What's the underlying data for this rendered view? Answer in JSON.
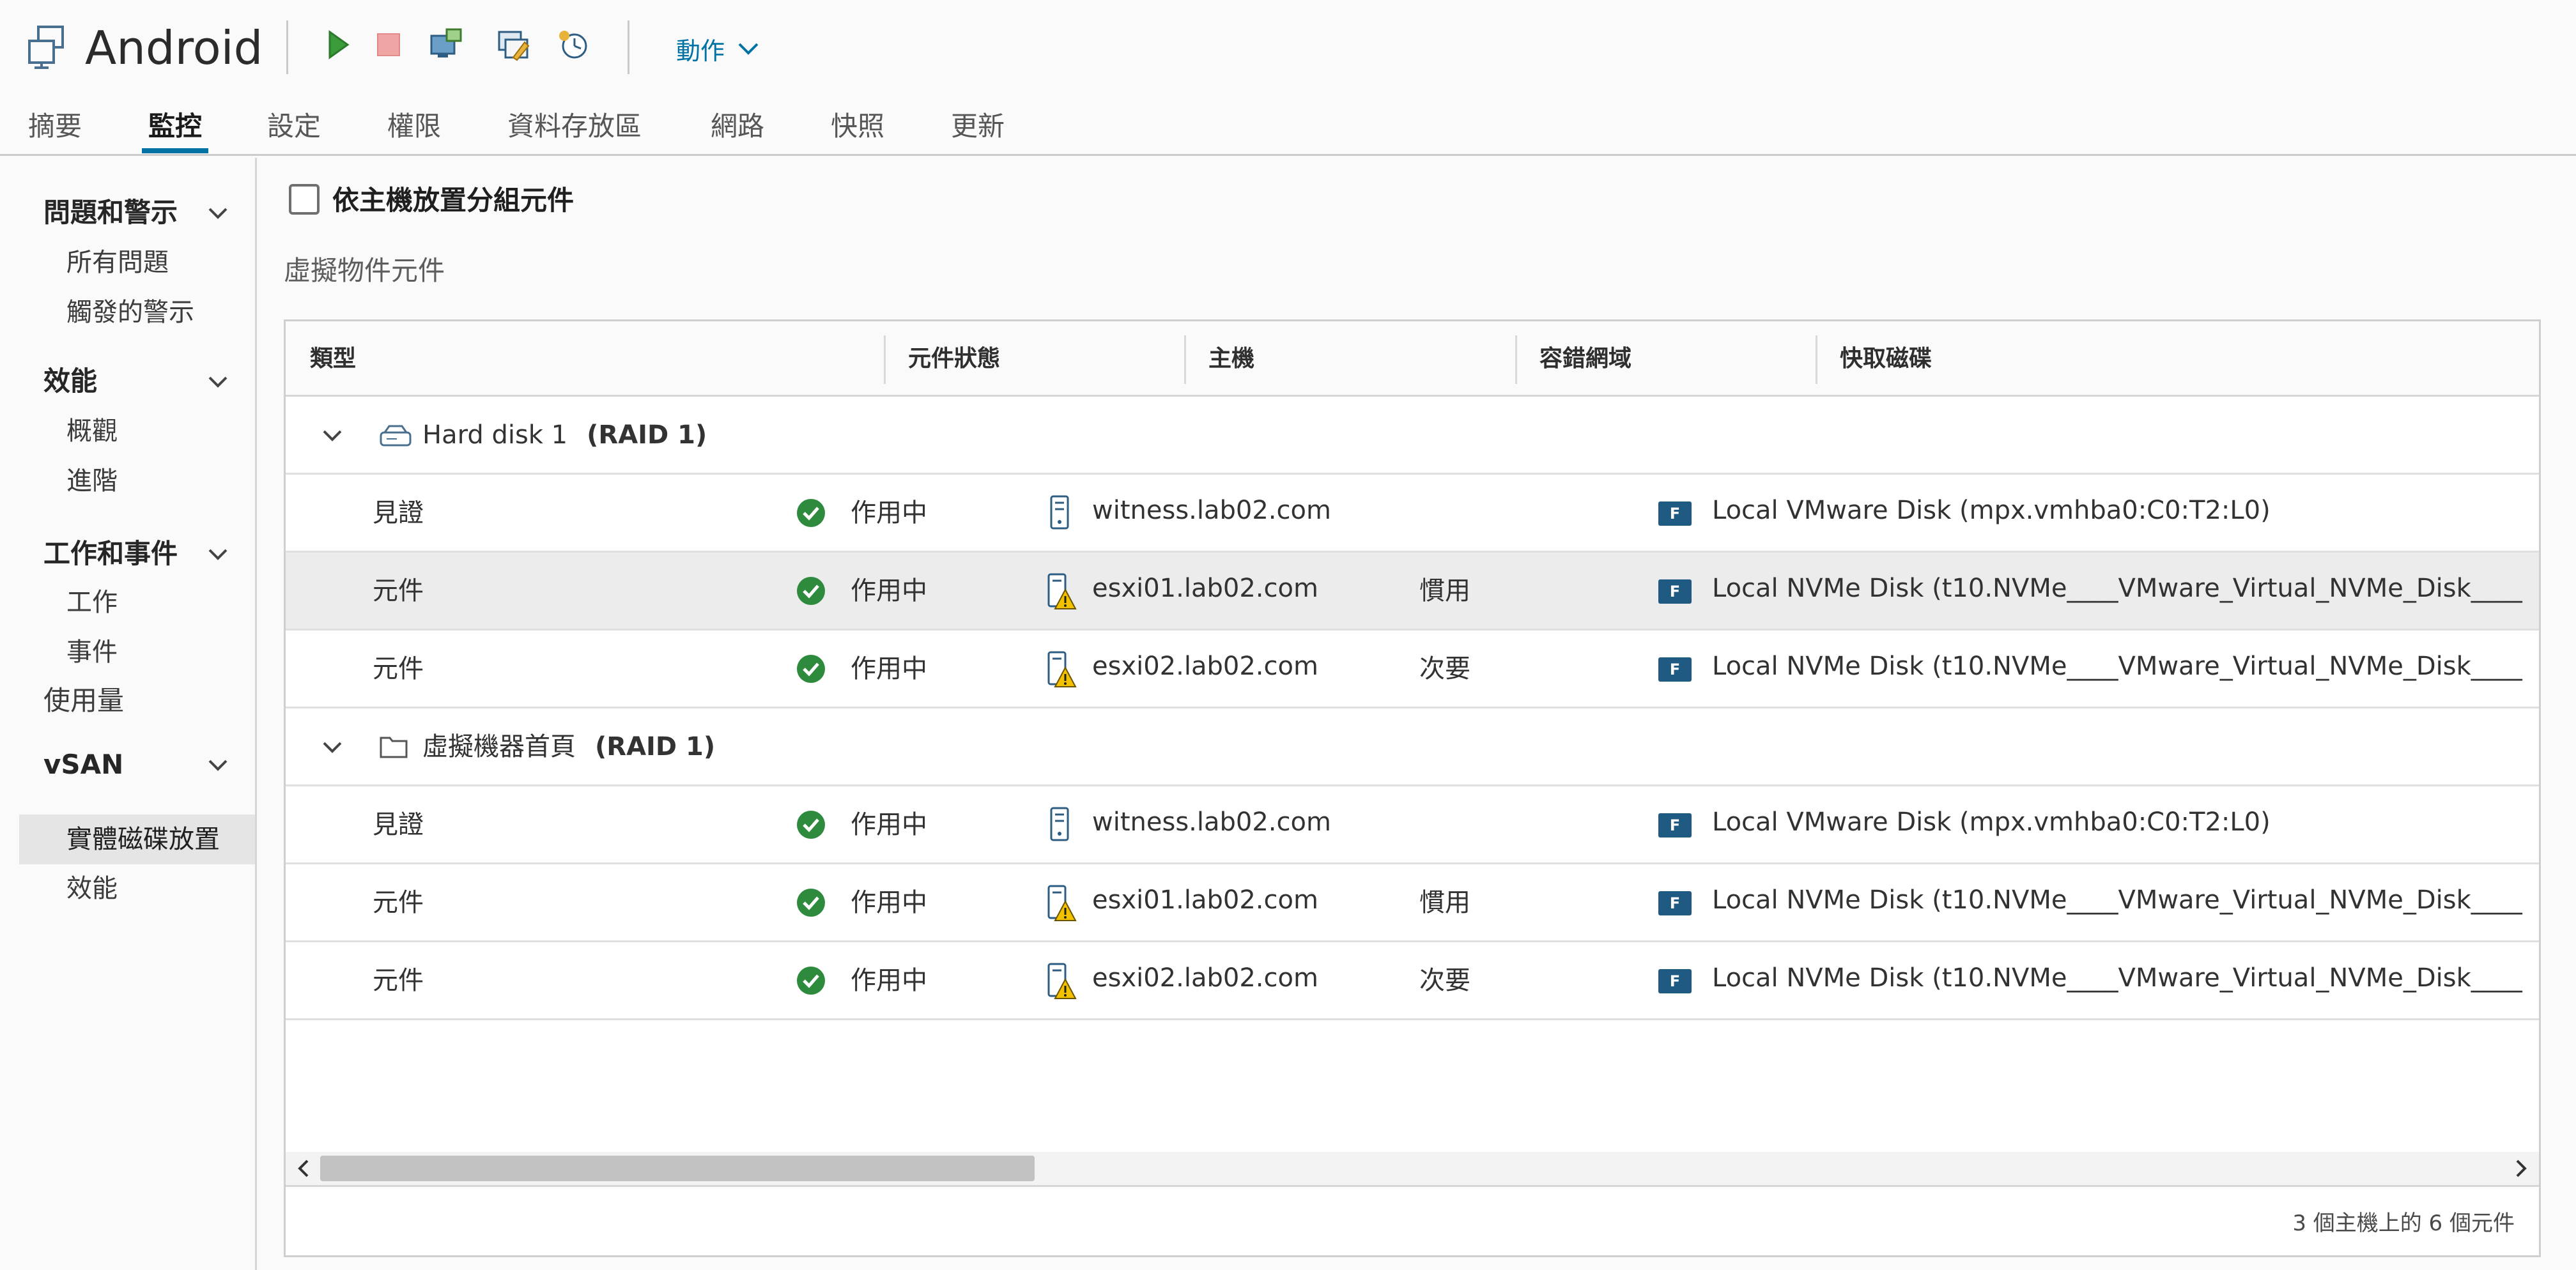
{
  "header": {
    "title": "Android",
    "actions_label": "動作"
  },
  "tabs": [
    "摘要",
    "監控",
    "設定",
    "權限",
    "資料存放區",
    "網路",
    "快照",
    "更新"
  ],
  "active_tab": "監控",
  "sidebar": {
    "issues": {
      "label": "問題和警示",
      "items": [
        "所有問題",
        "觸發的警示"
      ]
    },
    "performance": {
      "label": "效能",
      "items": [
        "概觀",
        "進階"
      ]
    },
    "tasks": {
      "label": "工作和事件",
      "items": [
        "工作",
        "事件"
      ]
    },
    "usage": "使用量",
    "vsan": {
      "label": "vSAN",
      "items": [
        "實體磁碟放置",
        "效能"
      ],
      "selected": "實體磁碟放置"
    }
  },
  "main": {
    "group_by_host_label": "依主機放置分組元件",
    "group_by_host_checked": false,
    "section_title": "虛擬物件元件",
    "columns": [
      "類型",
      "元件狀態",
      "主機",
      "容錯網域",
      "快取磁碟"
    ],
    "groups": [
      {
        "name": "Hard disk 1",
        "raid": "(RAID 1)",
        "icon": "hard-disk-icon",
        "rows": [
          {
            "type": "見證",
            "state": "作用中",
            "host": "witness.lab02.com",
            "host_icon": "witness-host-icon",
            "fault_domain": "",
            "cache_disk": "Local VMware Disk (mpx.vmhba0:C0:T2:L0)"
          },
          {
            "type": "元件",
            "state": "作用中",
            "host": "esxi01.lab02.com",
            "host_icon": "host-warning-icon",
            "fault_domain": "慣用",
            "cache_disk": "Local NVMe Disk (t10.NVMe____VMware_Virtual_NVMe_Disk____"
          },
          {
            "type": "元件",
            "state": "作用中",
            "host": "esxi02.lab02.com",
            "host_icon": "host-warning-icon",
            "fault_domain": "次要",
            "cache_disk": "Local NVMe Disk (t10.NVMe____VMware_Virtual_NVMe_Disk____"
          }
        ]
      },
      {
        "name": "虛擬機器首頁",
        "raid": "(RAID 1)",
        "icon": "folder-icon",
        "rows": [
          {
            "type": "見證",
            "state": "作用中",
            "host": "witness.lab02.com",
            "host_icon": "witness-host-icon",
            "fault_domain": "",
            "cache_disk": "Local VMware Disk (mpx.vmhba0:C0:T2:L0)"
          },
          {
            "type": "元件",
            "state": "作用中",
            "host": "esxi01.lab02.com",
            "host_icon": "host-warning-icon",
            "fault_domain": "慣用",
            "cache_disk": "Local NVMe Disk (t10.NVMe____VMware_Virtual_NVMe_Disk____"
          },
          {
            "type": "元件",
            "state": "作用中",
            "host": "esxi02.lab02.com",
            "host_icon": "host-warning-icon",
            "fault_domain": "次要",
            "cache_disk": "Local NVMe Disk (t10.NVMe____VMware_Virtual_NVMe_Disk____"
          }
        ]
      }
    ],
    "disk_badge": "F",
    "footer": "3 個主機上的 6 個元件"
  },
  "colors": {
    "accent": "#0072a3",
    "ok_green": "#2e8b3e",
    "warning_yellow": "#f2c200",
    "disk_badge_bg": "#1f5a83"
  }
}
